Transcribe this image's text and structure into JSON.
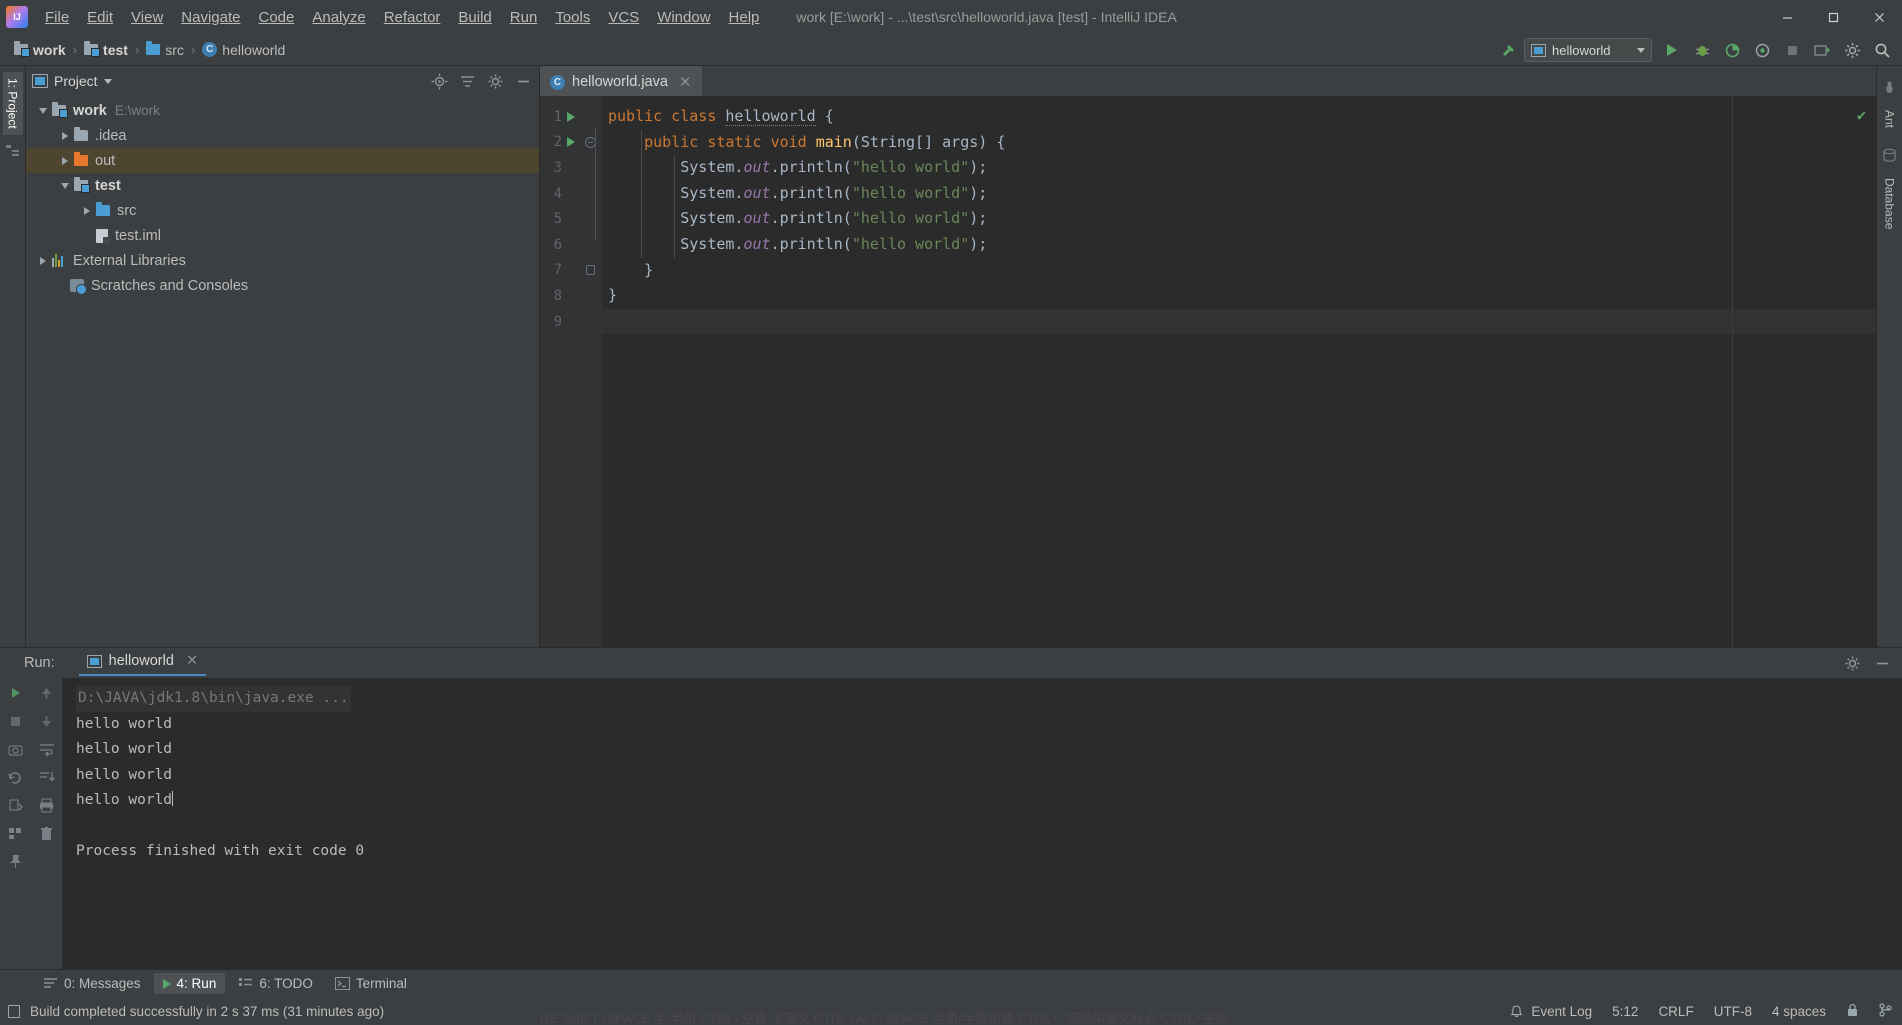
{
  "window": {
    "title": "work [E:\\work] - ...\\test\\src\\helloworld.java [test] - IntelliJ IDEA",
    "minimize": "—",
    "maximize": "☐",
    "close": "✕"
  },
  "menu": {
    "items": [
      {
        "label": "File",
        "mnemonic": "F"
      },
      {
        "label": "Edit",
        "mnemonic": "E"
      },
      {
        "label": "View",
        "mnemonic": "V"
      },
      {
        "label": "Navigate",
        "mnemonic": "N"
      },
      {
        "label": "Code",
        "mnemonic": "C"
      },
      {
        "label": "Analyze",
        "mnemonic": "z"
      },
      {
        "label": "Refactor",
        "mnemonic": "R"
      },
      {
        "label": "Build",
        "mnemonic": "B"
      },
      {
        "label": "Run",
        "mnemonic": "u"
      },
      {
        "label": "Tools",
        "mnemonic": "T"
      },
      {
        "label": "VCS",
        "mnemonic": "S"
      },
      {
        "label": "Window",
        "mnemonic": "W"
      },
      {
        "label": "Help",
        "mnemonic": "H"
      }
    ]
  },
  "breadcrumb": {
    "items": [
      {
        "label": "work",
        "icon": "module-icon"
      },
      {
        "label": "test",
        "icon": "module-icon"
      },
      {
        "label": "src",
        "icon": "folder-blue-icon"
      },
      {
        "label": "helloworld",
        "icon": "java-class-icon"
      }
    ],
    "separator": "›"
  },
  "toolbar": {
    "build_label": "build-hammer-icon",
    "run_config": "helloworld",
    "buttons": [
      "run-button",
      "debug-button",
      "run-coverage-button",
      "profiler-button",
      "stop-button",
      "update-button",
      "settings-button",
      "search-button"
    ]
  },
  "project_panel": {
    "title": "Project",
    "actions": [
      "locate-icon",
      "collapse-all-icon",
      "settings-gear-icon",
      "hide-icon"
    ],
    "tree": [
      {
        "label": "work",
        "sub": "E:\\work",
        "icon": "module-icon",
        "depth": 0,
        "twisty": "down",
        "bold": true,
        "selected": false
      },
      {
        "label": ".idea",
        "sub": "",
        "icon": "folder-gray-icon",
        "depth": 1,
        "twisty": "right",
        "bold": false,
        "selected": false
      },
      {
        "label": "out",
        "sub": "",
        "icon": "folder-orange-icon",
        "depth": 1,
        "twisty": "right",
        "bold": false,
        "selected": true
      },
      {
        "label": "test",
        "sub": "",
        "icon": "module-icon",
        "depth": 1,
        "twisty": "down",
        "bold": true,
        "selected": false
      },
      {
        "label": "src",
        "sub": "",
        "icon": "folder-blue-icon",
        "depth": 2,
        "twisty": "right",
        "bold": false,
        "selected": false
      },
      {
        "label": "test.iml",
        "sub": "",
        "icon": "iml-file-icon",
        "depth": 2,
        "twisty": "none",
        "bold": false,
        "selected": false
      },
      {
        "label": "External Libraries",
        "sub": "",
        "icon": "library-icon",
        "depth": 0,
        "twisty": "right",
        "bold": false,
        "selected": false
      },
      {
        "label": "Scratches and Consoles",
        "sub": "",
        "icon": "scratch-icon",
        "depth": 0,
        "twisty": "none",
        "bold": false,
        "selected": false
      }
    ]
  },
  "left_strip": {
    "tabs": [
      "1: Project"
    ],
    "icons": [
      "structure-icon",
      "favorites-icon"
    ]
  },
  "right_strip": {
    "tabs": [
      "Ant",
      "Database"
    ]
  },
  "editor": {
    "tab_label": "helloworld.java",
    "tab_close": "✕",
    "lines": [
      {
        "n": "1",
        "gutter_run": true,
        "fold": "none",
        "tokens": [
          {
            "t": "public ",
            "c": "k"
          },
          {
            "t": "class ",
            "c": "k"
          },
          {
            "t": "helloworld",
            "c": "cls"
          },
          {
            "t": " {",
            "c": "p"
          }
        ]
      },
      {
        "n": "2",
        "gutter_run": true,
        "fold": "circle",
        "tokens": [
          {
            "t": "    public ",
            "c": "k"
          },
          {
            "t": "static ",
            "c": "k"
          },
          {
            "t": "void ",
            "c": "k"
          },
          {
            "t": "main",
            "c": "fn"
          },
          {
            "t": "(String[] args) {",
            "c": "p"
          }
        ]
      },
      {
        "n": "3",
        "gutter_run": false,
        "fold": "none",
        "tokens": [
          {
            "t": "        System.",
            "c": "p"
          },
          {
            "t": "out",
            "c": "fld"
          },
          {
            "t": ".println(",
            "c": "p"
          },
          {
            "t": "\"hello world\"",
            "c": "s"
          },
          {
            "t": ");",
            "c": "p"
          }
        ]
      },
      {
        "n": "4",
        "gutter_run": false,
        "fold": "none",
        "tokens": [
          {
            "t": "        System.",
            "c": "p"
          },
          {
            "t": "out",
            "c": "fld"
          },
          {
            "t": ".println(",
            "c": "p"
          },
          {
            "t": "\"hello world\"",
            "c": "s"
          },
          {
            "t": ");",
            "c": "p"
          }
        ]
      },
      {
        "n": "5",
        "gutter_run": false,
        "fold": "none",
        "tokens": [
          {
            "t": "        System.",
            "c": "p"
          },
          {
            "t": "out",
            "c": "fld"
          },
          {
            "t": ".println(",
            "c": "p"
          },
          {
            "t": "\"hello world\"",
            "c": "s"
          },
          {
            "t": ");",
            "c": "p"
          }
        ]
      },
      {
        "n": "6",
        "gutter_run": false,
        "fold": "none",
        "tokens": [
          {
            "t": "        System.",
            "c": "p"
          },
          {
            "t": "out",
            "c": "fld"
          },
          {
            "t": ".println(",
            "c": "p"
          },
          {
            "t": "\"hello world\"",
            "c": "s"
          },
          {
            "t": ");",
            "c": "p"
          }
        ]
      },
      {
        "n": "7",
        "gutter_run": false,
        "fold": "brace",
        "tokens": [
          {
            "t": "    }",
            "c": "p"
          }
        ]
      },
      {
        "n": "8",
        "gutter_run": false,
        "fold": "none",
        "tokens": [
          {
            "t": "}",
            "c": "p"
          }
        ]
      },
      {
        "n": "9",
        "gutter_run": false,
        "fold": "none",
        "tokens": [
          {
            "t": "",
            "c": "p"
          }
        ]
      }
    ],
    "inspection_status": "✔"
  },
  "run_panel": {
    "label": "Run:",
    "tab": "helloworld",
    "tab_close": "✕",
    "actions": [
      "rerun-icon",
      "stop-icon",
      "up-arrow-icon",
      "down-arrow-icon",
      "soft-wrap-icon",
      "scroll-to-end-icon",
      "print-icon",
      "clear-all-icon",
      "settings-icon",
      "hide-icon"
    ],
    "console": {
      "command": "D:\\JAVA\\jdk1.8\\bin\\java.exe ...",
      "output": [
        "hello world",
        "hello world",
        "hello world",
        "hello world"
      ],
      "exit_message": "Process finished with exit code 0"
    }
  },
  "tool_windows": {
    "items": [
      {
        "label": "0: Messages",
        "mnemonic": "0",
        "icon": "messages-icon",
        "active": false
      },
      {
        "label": "4: Run",
        "mnemonic": "4",
        "icon": "run-icon",
        "active": true
      },
      {
        "label": "6: TODO",
        "mnemonic": "6",
        "icon": "todo-icon",
        "active": false
      },
      {
        "label": "Terminal",
        "mnemonic": "",
        "icon": "terminal-icon",
        "active": false
      }
    ]
  },
  "status_bar": {
    "message": "Build completed successfully in 2 s 37 ms (31 minutes ago)",
    "caret_position": "5:12",
    "line_separator": "CRLF",
    "encoding": "UTF-8",
    "indent": "4 spaces",
    "event_log": "Event Log",
    "ime_hint": "RE SHIFT+SPACE 全/半角 CTRL+空格 中英文 CTRL+ALT+SPACE 全角/半角切换 CTRL+. 切换中英文标点 CTRL+空格"
  }
}
